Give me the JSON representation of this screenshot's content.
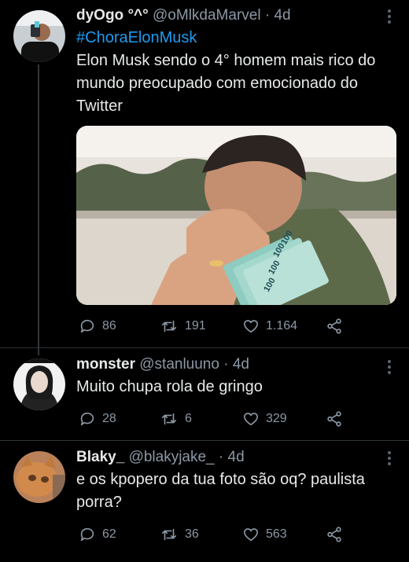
{
  "tweets": [
    {
      "name": "dyOgo °^°",
      "handle": "@oMlkdaMarvel",
      "dot": "·",
      "time": "4d",
      "hashtag": "#ChoraElonMusk",
      "text": "Elon Musk sendo o 4° homem mais rico do mundo preocupado com emocionado do Twitter",
      "replies": "86",
      "retweets": "191",
      "likes": "1.164"
    },
    {
      "name": "monster",
      "handle": "@stanluuno",
      "dot": "·",
      "time": "4d",
      "text": "Muito chupa rola de gringo",
      "replies": "28",
      "retweets": "6",
      "likes": "329"
    },
    {
      "name": "Blaky_",
      "handle": "@blakyjake_",
      "dot": "·",
      "time": "4d",
      "text": "e os kpopero da tua foto são oq? paulista porra?",
      "replies": "62",
      "retweets": "36",
      "likes": "563"
    }
  ],
  "media": {
    "banknote_label": "100",
    "colors": {
      "wall": "#e8e3dc",
      "shirt": "#5d6a4a",
      "skin": "#d9a382",
      "notes": "#8ecbc0"
    }
  },
  "colors": {
    "accent": "#1d9bf0",
    "muted": "#8b98a5",
    "background": "#000000",
    "text": "#e7e9ea"
  }
}
